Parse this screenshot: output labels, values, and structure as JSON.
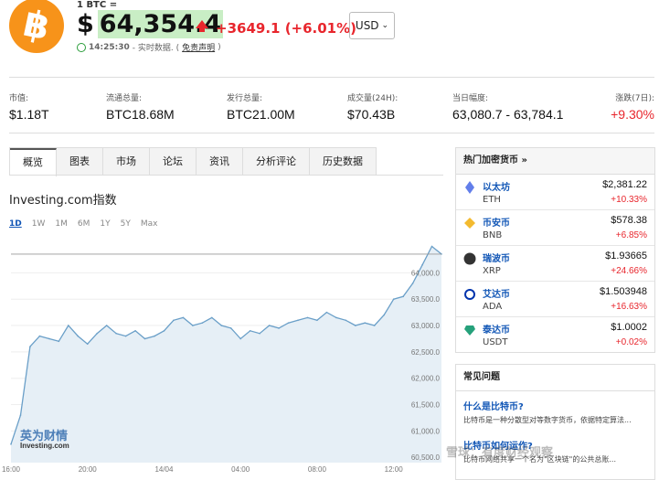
{
  "header": {
    "logo_glyph": "฿",
    "unit_label": "1 BTC =",
    "currency_symbol": "$",
    "price": "64,354.4",
    "change_abs": "+3649.1",
    "change_pct": "(+6.01%)",
    "time": "14:25:30",
    "time_note": "- 实时数据. (",
    "disclaimer": "免责声明",
    "time_close": ")",
    "currency_select": "USD",
    "accent_up": "#e8262d",
    "brand_orange": "#f7931a"
  },
  "stats": [
    {
      "label": "市值:",
      "value": "$1.18T"
    },
    {
      "label": "流通总量:",
      "value": "BTC18.68M"
    },
    {
      "label": "发行总量:",
      "value": "BTC21.00M"
    },
    {
      "label": "成交量(24H):",
      "value": "$70.43B"
    },
    {
      "label": "当日幅度:",
      "value": "63,080.7 - 63,784.1"
    },
    {
      "label": "涨跌(7日):",
      "value": "+9.30%"
    }
  ],
  "tabs": [
    "概览",
    "图表",
    "市场",
    "论坛",
    "资讯",
    "分析评论",
    "历史数据"
  ],
  "chart_title": "Investing.com指数",
  "ranges": [
    "1D",
    "1W",
    "1M",
    "6M",
    "1Y",
    "5Y",
    "Max"
  ],
  "watermark": {
    "line1": "英为财情",
    "line2": "Investing.com"
  },
  "chart_data": {
    "type": "area",
    "x": [
      "16:00",
      "16:30",
      "17:00",
      "17:30",
      "18:00",
      "18:30",
      "19:00",
      "19:30",
      "20:00",
      "20:30",
      "21:00",
      "21:30",
      "22:00",
      "22:30",
      "23:00",
      "23:30",
      "14/04",
      "00:30",
      "01:00",
      "01:30",
      "02:00",
      "02:30",
      "03:00",
      "03:30",
      "04:00",
      "04:30",
      "05:00",
      "05:30",
      "06:00",
      "06:30",
      "07:00",
      "07:30",
      "08:00",
      "08:30",
      "09:00",
      "09:30",
      "10:00",
      "10:30",
      "11:00",
      "11:30",
      "12:00",
      "12:30",
      "13:00",
      "13:30",
      "14:00",
      "14:25"
    ],
    "values": [
      60750,
      61300,
      62600,
      62800,
      62750,
      62700,
      63000,
      62800,
      62650,
      62850,
      63000,
      62850,
      62800,
      62900,
      62750,
      62800,
      62900,
      63100,
      63150,
      63000,
      63050,
      63150,
      63000,
      62950,
      62750,
      62900,
      62850,
      63000,
      62950,
      63050,
      63100,
      63150,
      63100,
      63250,
      63150,
      63100,
      63000,
      63050,
      63000,
      63200,
      63500,
      63550,
      63800,
      64150,
      64500,
      64354.4
    ],
    "xticks": [
      "16:00",
      "20:00",
      "14/04",
      "04:00",
      "08:00",
      "12:00"
    ],
    "yticks": [
      "64,000.0",
      "63,500.0",
      "63,000.0",
      "62,500.0",
      "62,000.0",
      "61,500.0",
      "61,000.0",
      "60,500.0"
    ],
    "ylim": [
      60400,
      64700
    ],
    "last_value": 64354.4,
    "line_color": "#6a9fc8",
    "fill_color": "#e6eff6"
  },
  "trending": {
    "title": "热门加密货币 »",
    "items": [
      {
        "name": "以太坊",
        "symbol": "ETH",
        "price": "$2,381.22",
        "change": "+10.33%",
        "icon": "ethereum-icon",
        "color": "#627eea"
      },
      {
        "name": "币安币",
        "symbol": "BNB",
        "price": "$578.38",
        "change": "+6.85%",
        "icon": "binance-icon",
        "color": "#f3ba2f"
      },
      {
        "name": "瑞波币",
        "symbol": "XRP",
        "price": "$1.93665",
        "change": "+24.66%",
        "icon": "xrp-icon",
        "color": "#333333"
      },
      {
        "name": "艾达币",
        "symbol": "ADA",
        "price": "$1.503948",
        "change": "+16.63%",
        "icon": "cardano-icon",
        "color": "#0033ad"
      },
      {
        "name": "泰达币",
        "symbol": "USDT",
        "price": "$1.0002",
        "change": "+0.02%",
        "icon": "tether-icon",
        "color": "#26a17b"
      }
    ]
  },
  "faq": {
    "title": "常见问题",
    "q1": "什么是比特币?",
    "a1": "比特币是一种分散型对等数字货币，依据特定算法...",
    "q2": "比特币如何运作?",
    "a2": "比特币网络共享一个名为\"区块链\"的公共总账..."
  },
  "bottom_watermark": "雪球：有度财经观察"
}
